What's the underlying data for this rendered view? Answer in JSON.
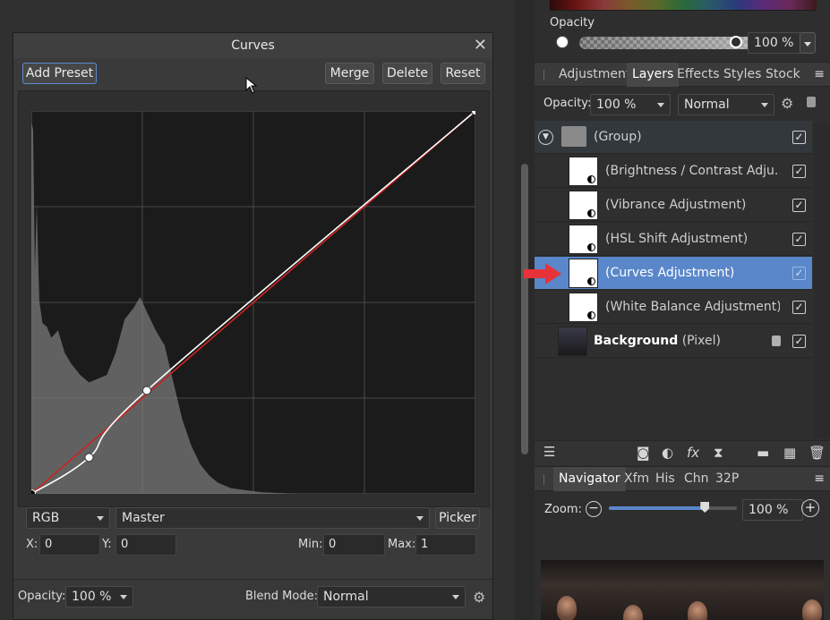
{
  "curves": {
    "title": "Curves",
    "close_glyph": "✕",
    "buttons": {
      "add_preset": "Add Preset",
      "merge": "Merge",
      "delete": "Delete",
      "reset": "Reset",
      "picker": "Picker"
    },
    "channel": "RGB",
    "mode": "Master",
    "x_label": "X:",
    "x_value": "0",
    "y_label": "Y:",
    "y_value": "0",
    "min_label": "Min:",
    "min_value": "0",
    "max_label": "Max:",
    "max_value": "1",
    "opacity_label": "Opacity:",
    "opacity_value": "100 %",
    "blend_label": "Blend Mode:",
    "blend_value": "Normal",
    "control_points": [
      [
        0,
        0
      ],
      [
        0.13,
        0.095
      ],
      [
        0.26,
        0.27
      ],
      [
        1,
        1
      ]
    ],
    "colors": {
      "curve": "#ffffff",
      "diagonal": "#cc2222",
      "histogram": "#7a7a7a"
    }
  },
  "right": {
    "opacity_label": "Opacity",
    "opacity_value": "100 %",
    "tabs": [
      "Adjustment",
      "Layers",
      "Effects",
      "Styles",
      "Stock"
    ],
    "active_tab": "Layers",
    "layers_opacity_label": "Opacity:",
    "layers_opacity_value": "100 %",
    "layers_blend": "Normal",
    "layers": [
      {
        "name": "(Group)"
      },
      {
        "name": "(Brightness / Contrast Adju..."
      },
      {
        "name": "(Vibrance Adjustment)"
      },
      {
        "name": "(HSL Shift Adjustment)"
      },
      {
        "name": "(Curves Adjustment)",
        "selected": true
      },
      {
        "name": "(White Balance Adjustment)"
      },
      {
        "name_bold": "Background",
        "name_suffix": "(Pixel)"
      }
    ],
    "check_glyph": "✓",
    "nav_tabs": [
      "Navigator",
      "Xfm",
      "His",
      "Chn",
      "32P"
    ],
    "zoom_label": "Zoom:",
    "zoom_value": "100 %",
    "zoom_level": 0.75,
    "accent_color": "#5a87c9"
  }
}
